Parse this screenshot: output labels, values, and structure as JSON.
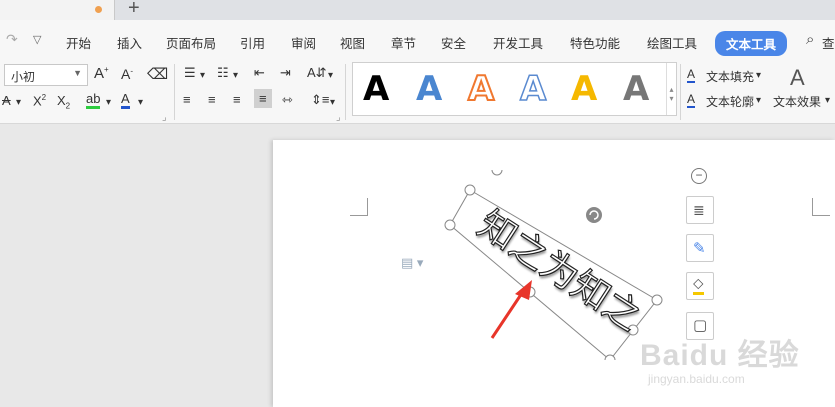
{
  "menu": {
    "items": [
      "开始",
      "插入",
      "页面布局",
      "引用",
      "审阅",
      "视图",
      "章节",
      "安全",
      "开发工具",
      "特色功能",
      "绘图工具",
      "文本工具"
    ],
    "search_label": "查"
  },
  "toolbar": {
    "font_size": "小初",
    "text_fill_label": "文本填充",
    "text_outline_label": "文本轮廓",
    "text_effect_label": "文本效果",
    "wordart_sample": "A",
    "wordart_styles": [
      {
        "color": "#000000",
        "name": "black"
      },
      {
        "color": "#4a86d0",
        "name": "blue"
      },
      {
        "color": "#f07830",
        "name": "orange-outline"
      },
      {
        "color": "#5a8ad0",
        "name": "blue-outline"
      },
      {
        "color": "#f5b800",
        "name": "gold"
      },
      {
        "color": "#777777",
        "name": "gray-gradient"
      }
    ]
  },
  "document": {
    "wordart_text": "知之为知之"
  },
  "colors": {
    "accent": "#4a86e8",
    "arrow": "#e8352a"
  },
  "watermark": {
    "main": "Baidu 经验",
    "sub": "jingyan.baidu.com"
  }
}
